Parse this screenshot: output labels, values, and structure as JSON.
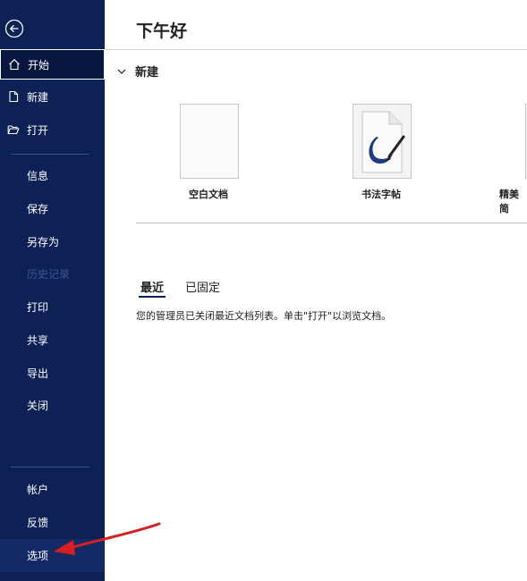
{
  "sidebar": {
    "top_items": [
      {
        "label": "开始",
        "icon": "home-icon"
      },
      {
        "label": "新建",
        "icon": "new-document-icon"
      },
      {
        "label": "打开",
        "icon": "open-folder-icon"
      }
    ],
    "mid_items": [
      "信息",
      "保存",
      "另存为",
      "历史记录",
      "打印",
      "共享",
      "导出",
      "关闭"
    ],
    "bottom_items": [
      "帐户",
      "反馈",
      "选项"
    ]
  },
  "main": {
    "greeting": "下午好",
    "new_section": "新建",
    "templates": [
      "空白文档",
      "书法字帖",
      "精美简"
    ],
    "tabs": [
      "最近",
      "已固定"
    ],
    "notice": "您的管理员已关闭最近文档列表。单击\"打开\"以浏览文档。"
  },
  "colors": {
    "sidebar": "#0d2157",
    "arrow": "#d62020"
  }
}
